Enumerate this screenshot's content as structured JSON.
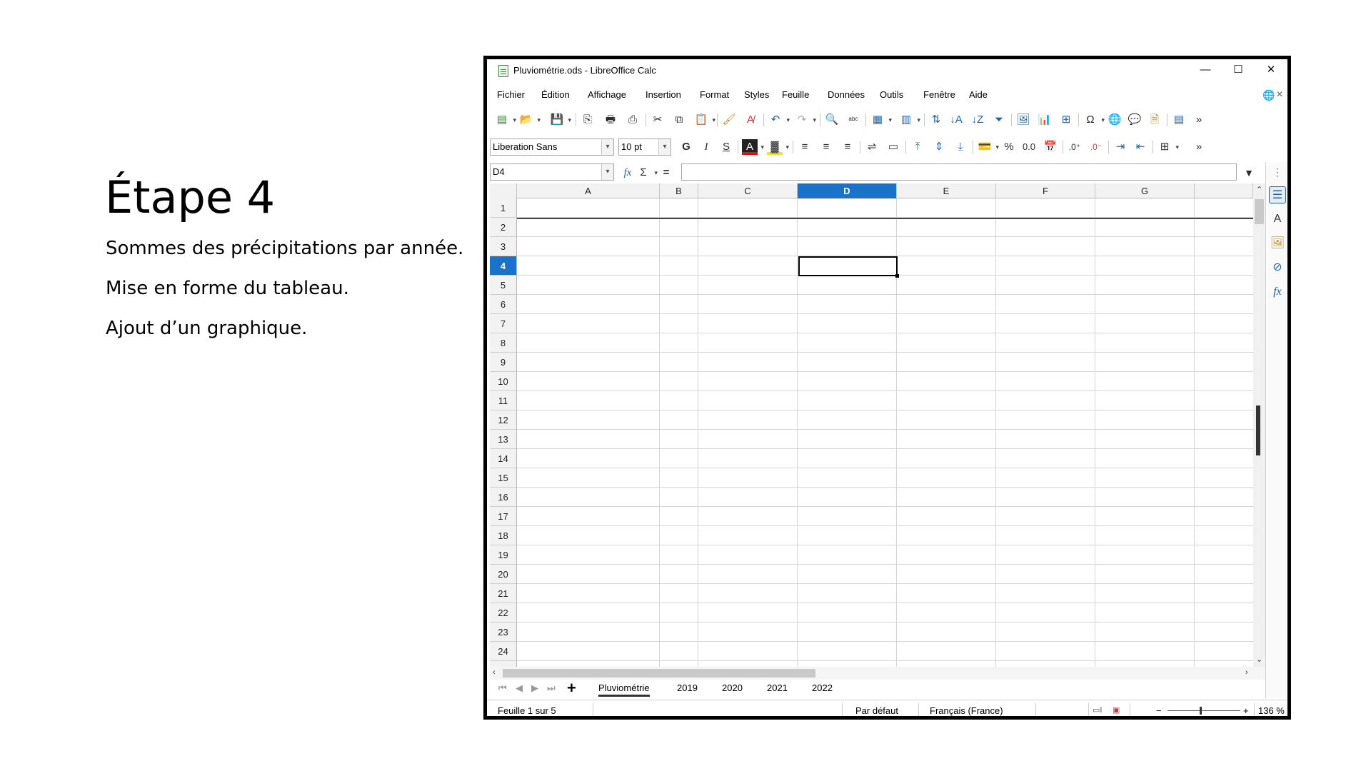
{
  "slide": {
    "title": "Étape 4",
    "lines": [
      "Sommes des précipitations par année.",
      "Mise en forme du tableau.",
      "Ajout d’un graphique."
    ]
  },
  "window": {
    "title": "Pluviométrie.ods - LibreOffice Calc",
    "controls": {
      "minimize": "—",
      "maximize": "☐",
      "close": "✕"
    }
  },
  "menu": {
    "items": [
      "Fichier",
      "Édition",
      "Affichage",
      "Insertion",
      "Format",
      "Styles",
      "Feuille",
      "Données",
      "Outils",
      "Fenêtre",
      "Aide"
    ]
  },
  "toolbar": {
    "font_name": "Liberation Sans",
    "font_size": "10 pt",
    "bold": "G",
    "italic": "I",
    "underline": "S",
    "percent": "%",
    "decimal_number": "0.0"
  },
  "formula_bar": {
    "cell_reference": "D4",
    "function_wizard": "fx",
    "sum": "Σ",
    "equals": "=",
    "formula": ""
  },
  "grid": {
    "columns": [
      "A",
      "B",
      "C",
      "D",
      "E",
      "F",
      "G"
    ],
    "active_column": "D",
    "rows": [
      "1",
      "2",
      "3",
      "4",
      "5",
      "6",
      "7",
      "8",
      "9",
      "10",
      "11",
      "12",
      "13",
      "14",
      "15",
      "16",
      "17",
      "18",
      "19",
      "20",
      "21",
      "22",
      "23",
      "24"
    ],
    "active_row": "4",
    "active_cell": "D4"
  },
  "sheets": {
    "tabs": [
      "Pluviométrie",
      "2019",
      "2020",
      "2021",
      "2022"
    ],
    "active": "Pluviométrie",
    "add_label": "+"
  },
  "status": {
    "sheet_position": "Feuille 1 sur 5",
    "page_style": "Par défaut",
    "language": "Français (France)",
    "zoom": "136 %"
  },
  "colors": {
    "accent": "#1a73c8",
    "window_border": "#000000"
  }
}
